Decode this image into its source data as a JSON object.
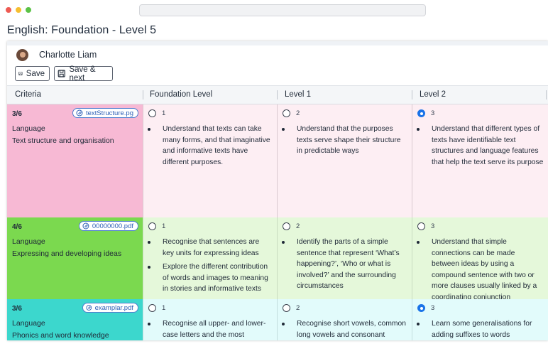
{
  "page": {
    "title": "English: Foundation - Level 5"
  },
  "user": {
    "name": "Charlotte Liam"
  },
  "toolbar": {
    "save_label": "Save",
    "save_next_label": "Save & next"
  },
  "columns": [
    "Criteria",
    "Foundation Level",
    "Level 1",
    "Level 2"
  ],
  "rows": [
    {
      "count": "3/6",
      "attachment": "textStructure.pg",
      "area": "Language",
      "subarea": "Text structure and organisation",
      "selected_level": 2,
      "levels": [
        {
          "num": "1",
          "bullets": [
            "Understand that texts can take many forms, and that imaginative and informative texts have different purposes."
          ]
        },
        {
          "num": "2",
          "bullets": [
            "Understand that the purposes texts serve shape their structure in predictable ways"
          ]
        },
        {
          "num": "3",
          "bullets": [
            "Understand that different types of texts have identifiable text structures and language features that help the text serve its purpose"
          ]
        }
      ]
    },
    {
      "count": "4/6",
      "attachment": "00000000.pdf",
      "area": "Language",
      "subarea": "Expressing and developing ideas",
      "selected_level": null,
      "levels": [
        {
          "num": "1",
          "bullets": [
            "Recognise that sentences are key units for expressing ideas",
            "Explore the different contribution of words and images to meaning in stories and informative texts"
          ]
        },
        {
          "num": "2",
          "bullets": [
            "Identify the parts of a simple sentence that represent ‘What’s happening?’, ‘Who or what is involved?’ and the surrounding circumstances"
          ]
        },
        {
          "num": "3",
          "bullets": [
            "Understand that simple connections can be made between ideas by using a compound sentence with two or more clauses usually linked by a coordinating conjunction"
          ]
        }
      ]
    },
    {
      "count": "3/6",
      "attachment": "examplar.pdf",
      "area": "Language",
      "subarea": "Phonics and word knowledge",
      "selected_level": 2,
      "levels": [
        {
          "num": "1",
          "bullets": [
            "Recognise all upper- and lower-case letters and the most"
          ]
        },
        {
          "num": "2",
          "bullets": [
            "Recognise short vowels, common long vowels and consonant"
          ]
        },
        {
          "num": "3",
          "bullets": [
            "Learn some generalisations for adding suffixes to words"
          ]
        }
      ]
    }
  ],
  "colors": {
    "row1_criteria": "#f7b9d4",
    "row1_level": "#fdeef3",
    "row2_criteria": "#7bd94f",
    "row2_level": "#e5f8da",
    "row3_criteria": "#3cd7cd",
    "row3_level": "#e2fbfb",
    "accent": "#1a73e8"
  }
}
